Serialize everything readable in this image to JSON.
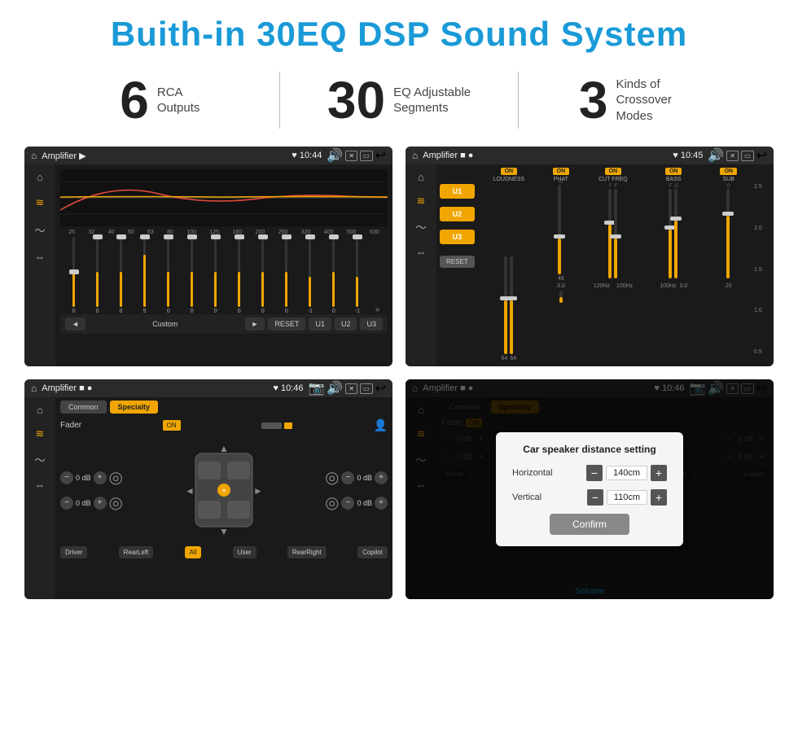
{
  "header": {
    "title": "Buith-in 30EQ DSP Sound System"
  },
  "stats": [
    {
      "number": "6",
      "label": "RCA\nOutputs"
    },
    {
      "number": "30",
      "label": "EQ Adjustable\nSegments"
    },
    {
      "number": "3",
      "label": "Kinds of\nCrossover Modes"
    }
  ],
  "screen1": {
    "status": "Amplifier",
    "time": "10:44",
    "eq_labels": [
      "25",
      "32",
      "40",
      "50",
      "63",
      "80",
      "100",
      "125",
      "160",
      "200",
      "250",
      "320",
      "400",
      "500",
      "630"
    ],
    "eq_values": [
      "0",
      "0",
      "0",
      "5",
      "0",
      "0",
      "0",
      "0",
      "0",
      "0",
      "-1",
      "0",
      "-1"
    ],
    "buttons": [
      "Custom",
      "RESET",
      "U1",
      "U2",
      "U3"
    ]
  },
  "screen2": {
    "status": "Amplifier",
    "time": "10:45",
    "u_buttons": [
      "U1",
      "U2",
      "U3"
    ],
    "controls": [
      "LOUDNESS",
      "PHAT",
      "CUT FREQ",
      "BASS",
      "SUB"
    ],
    "reset_label": "RESET"
  },
  "screen3": {
    "status": "Amplifier",
    "time": "10:46",
    "tabs": [
      "Common",
      "Specialty"
    ],
    "fader_label": "Fader",
    "fader_on": "ON",
    "positions": [
      "Driver",
      "RearLeft",
      "All",
      "User",
      "RearRight",
      "Copilot"
    ],
    "db_values": [
      "0 dB",
      "0 dB",
      "0 dB",
      "0 dB"
    ]
  },
  "screen4": {
    "status": "Amplifier",
    "time": "10:46",
    "dialog": {
      "title": "Car speaker distance setting",
      "horizontal_label": "Horizontal",
      "horizontal_value": "140cm",
      "vertical_label": "Vertical",
      "vertical_value": "110cm",
      "confirm_label": "Confirm"
    }
  },
  "watermark": "Seicane"
}
